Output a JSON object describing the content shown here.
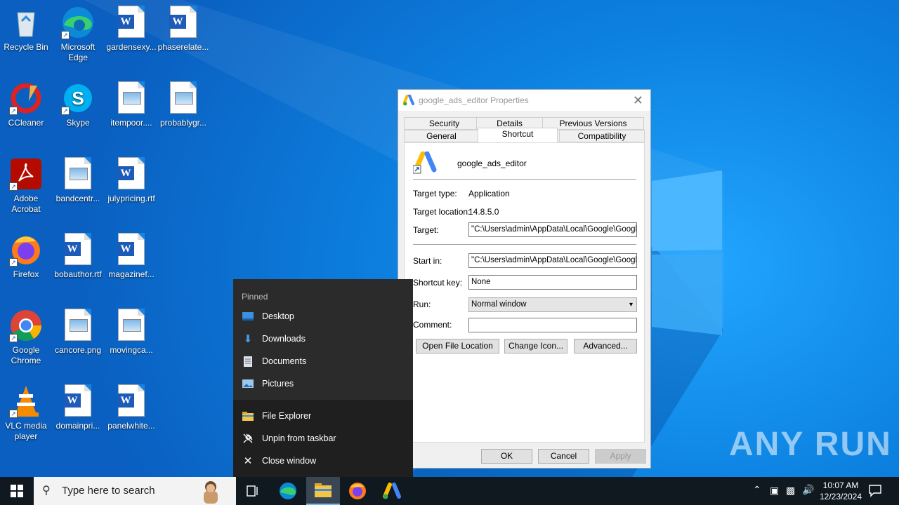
{
  "desktop": {
    "icons": [
      {
        "label": "Recycle Bin"
      },
      {
        "label": "Microsoft Edge"
      },
      {
        "label": "gardensexy..."
      },
      {
        "label": "phaserelate..."
      },
      {
        "label": "CCleaner"
      },
      {
        "label": "Skype"
      },
      {
        "label": "itempoor...."
      },
      {
        "label": "probablygr..."
      },
      {
        "label": "Adobe Acrobat"
      },
      {
        "label": "bandcentr..."
      },
      {
        "label": "julypricing.rtf"
      },
      {
        "label": "Firefox"
      },
      {
        "label": "bobauthor.rtf"
      },
      {
        "label": "magazinef..."
      },
      {
        "label": "Google Chrome"
      },
      {
        "label": "cancore.png"
      },
      {
        "label": "movingca..."
      },
      {
        "label": "VLC media player"
      },
      {
        "label": "domainpri..."
      },
      {
        "label": "panelwhite..."
      }
    ]
  },
  "jumplist": {
    "header": "Pinned",
    "pinned": [
      {
        "label": "Desktop",
        "icon": "desktop-folder-icon"
      },
      {
        "label": "Downloads",
        "icon": "download-arrow-icon"
      },
      {
        "label": "Documents",
        "icon": "document-icon"
      },
      {
        "label": "Pictures",
        "icon": "pictures-icon"
      }
    ],
    "actions": [
      {
        "label": "File Explorer",
        "icon": "folder-icon"
      },
      {
        "label": "Unpin from taskbar",
        "icon": "unpin-icon"
      },
      {
        "label": "Close window",
        "icon": "close-icon"
      }
    ]
  },
  "dialog": {
    "title": "google_ads_editor Properties",
    "tabs_row1": [
      "Security",
      "Details",
      "Previous Versions"
    ],
    "tabs_row2": [
      "General",
      "Shortcut",
      "Compatibility"
    ],
    "active_tab": "Shortcut",
    "name": "google_ads_editor",
    "target_type_label": "Target type:",
    "target_type_value": "Application",
    "target_location_label": "Target location:",
    "target_location_value": "14.8.5.0",
    "target_label": "Target:",
    "target_value": "\"C:\\Users\\admin\\AppData\\Local\\Google\\Google",
    "start_in_label": "Start in:",
    "start_in_value": "\"C:\\Users\\admin\\AppData\\Local\\Google\\Google",
    "shortcut_key_label": "Shortcut key:",
    "shortcut_key_value": "None",
    "run_label": "Run:",
    "run_value": "Normal window",
    "comment_label": "Comment:",
    "comment_value": "",
    "btn_open_location": "Open File Location",
    "btn_change_icon": "Change Icon...",
    "btn_advanced": "Advanced...",
    "btn_ok": "OK",
    "btn_cancel": "Cancel",
    "btn_apply": "Apply"
  },
  "taskbar": {
    "search_placeholder": "Type here to search",
    "time": "10:07 AM",
    "date": "12/23/2024"
  },
  "watermark": "ANY RUN"
}
